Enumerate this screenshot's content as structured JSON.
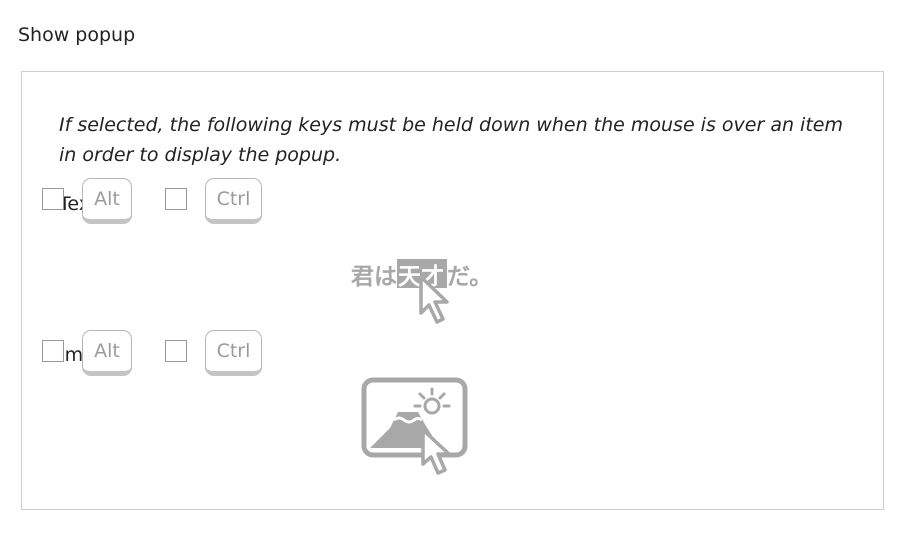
{
  "section": {
    "title": "Show popup"
  },
  "panel": {
    "description": "If selected, the following keys must be held down when the mouse is over an item in order to display the popup.",
    "text_group": {
      "label": "Text",
      "alt_key": "Alt",
      "ctrl_key": "Ctrl",
      "alt_checked": false,
      "ctrl_checked": false,
      "illustration": {
        "before": "君は",
        "highlighted": "天才",
        "after": "だ。"
      }
    },
    "images_group": {
      "label": "Images",
      "alt_key": "Alt",
      "ctrl_key": "Ctrl",
      "alt_checked": false,
      "ctrl_checked": false,
      "illustration_icon": "mountain-sun-picture-icon"
    }
  },
  "colors": {
    "text": "#222222",
    "border": "#cfcfcf",
    "key_text": "#9b9b9b",
    "illustration_gray": "#a8a8a8"
  }
}
